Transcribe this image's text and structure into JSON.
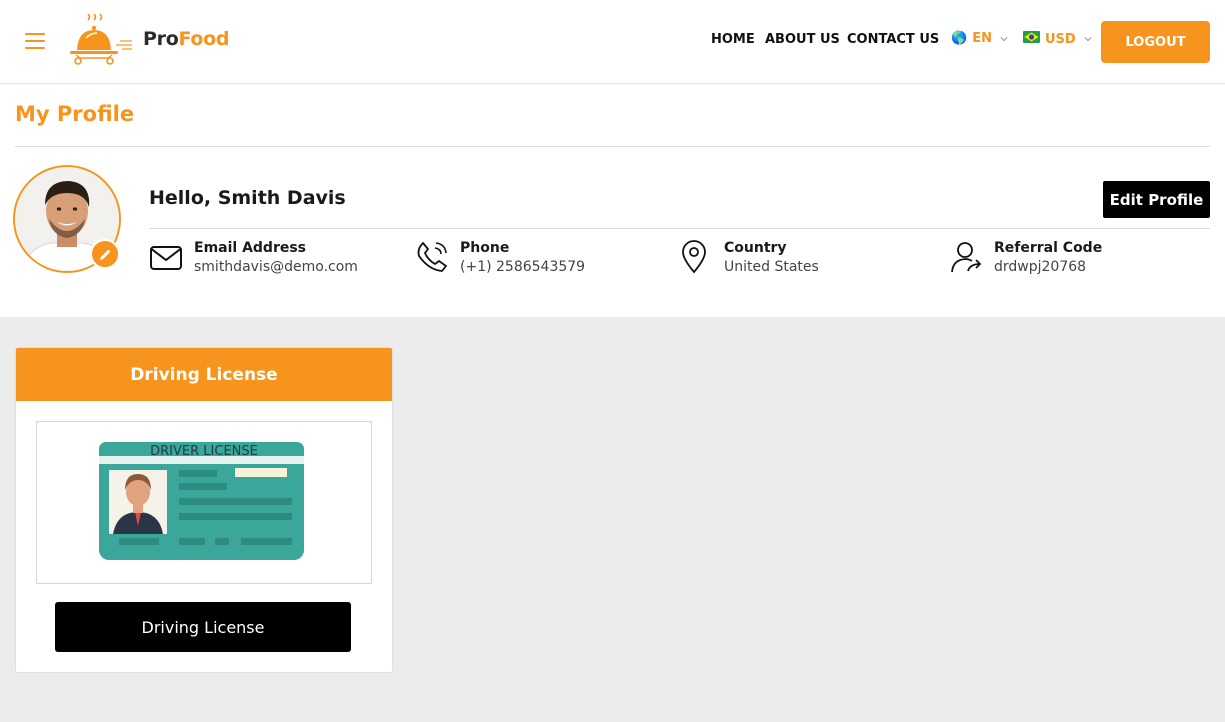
{
  "brand": {
    "name_part1": "Pro",
    "name_part2": "Food",
    "accent_color": "#f7941d"
  },
  "nav": {
    "home": "HOME",
    "about": "ABOUT US",
    "contact": "CONTACT US",
    "language": {
      "flag_icon": "globe-icon",
      "label": "EN"
    },
    "currency": {
      "flag_icon": "brazil-flag-icon",
      "label": "USD"
    },
    "logout": "LOGOUT"
  },
  "profile": {
    "page_title": "My Profile",
    "greeting": "Hello, Smith Davis",
    "edit_button": "Edit Profile",
    "fields": [
      {
        "icon": "envelope-icon",
        "label": "Email Address",
        "value": "smithdavis@demo.com"
      },
      {
        "icon": "phone-icon",
        "label": "Phone",
        "value": "(+1) 2586543579"
      },
      {
        "icon": "map-pin-icon",
        "label": "Country",
        "value": "United States"
      },
      {
        "icon": "user-share-icon",
        "label": "Referral Code",
        "value": "drdwpj20768"
      }
    ]
  },
  "license_card": {
    "header": "Driving License",
    "image_label": "DRIVER LICENSE",
    "button": "Driving License"
  }
}
